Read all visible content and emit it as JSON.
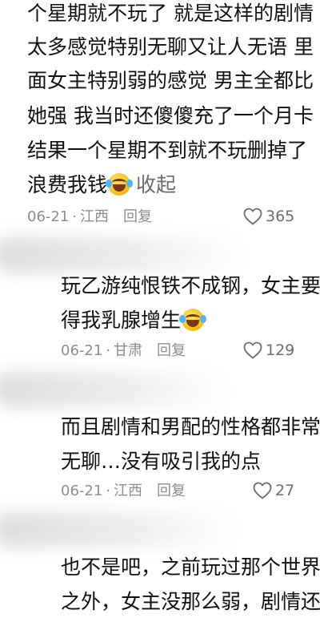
{
  "main_comment": {
    "lines": [
      "个星期就不玩了 就是这样的剧情",
      "太多感觉特别无聊又让人无语 里",
      "面女主特别弱的感觉 男主全都比",
      "她强 我当时还傻傻充了一个月卡",
      "结果一个星期不到就不玩删掉了"
    ],
    "last_line": "浪费我钱",
    "emoji": "laugh-cry-emoji",
    "collapse_label": "收起",
    "date": "06-21",
    "location": "江西",
    "reply_label": "回复",
    "likes": "365"
  },
  "replies": [
    {
      "lines": [
        "玩乙游纯恨铁不成钢，女主要",
        "得我乳腺增生"
      ],
      "date": "06-21",
      "location": "甘肃",
      "reply_label": "回复",
      "likes": "129"
    },
    {
      "lines": [
        "而且剧情和男配的性格都非常",
        "无聊…没有吸引我的点"
      ],
      "date": "06-21",
      "location": "江西",
      "reply_label": "回复",
      "likes": "27"
    },
    {
      "lines": [
        "也不是吧，之前玩过那个世界",
        "之外，女主没那么弱，剧情还"
      ]
    }
  ],
  "colors": {
    "text": "#111111",
    "meta": "#8d8d8d",
    "heart": "#6e6e6e"
  }
}
